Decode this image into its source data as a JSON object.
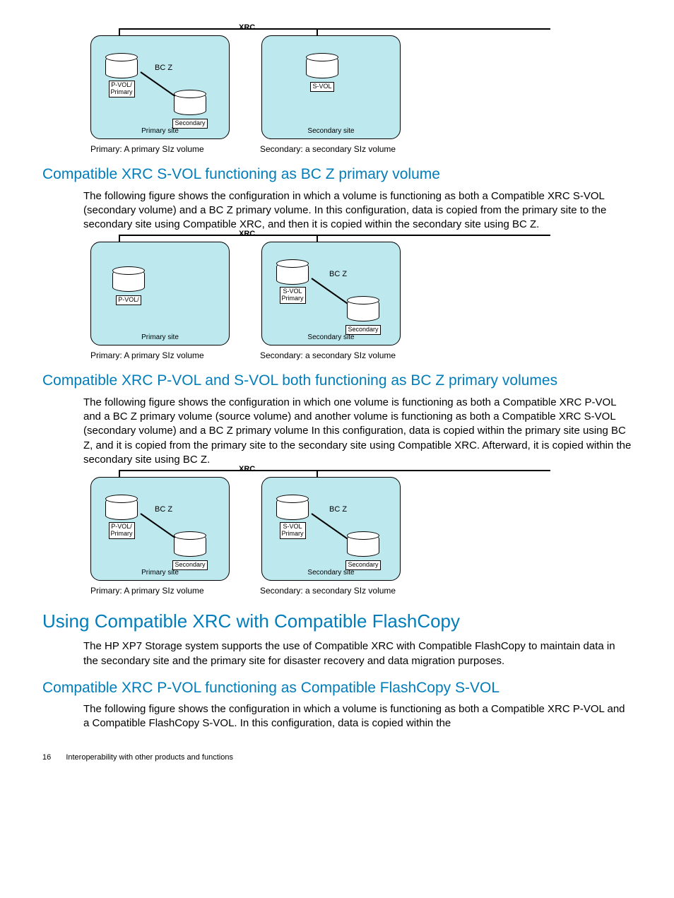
{
  "diagrams": {
    "common": {
      "xrc": "XRC",
      "bcz": "BC Z",
      "primary_site": "Primary site",
      "secondary_site": "Secondary site",
      "caption_left": "Primary: A primary SIz volume",
      "caption_right": "Secondary: a secondary SIz volume",
      "pvol": "P-VOL/",
      "pvol_primary": "Primary",
      "svol": "S-VOL",
      "svol_primary": "Primary",
      "secondary_vol": "Secondary"
    }
  },
  "headings": {
    "h3_a": "Compatible XRC S-VOL functioning as BC Z primary volume",
    "h3_b": "Compatible XRC P-VOL and S-VOL both functioning as BC Z primary volumes",
    "h2_c": "Using Compatible XRC with Compatible FlashCopy",
    "h3_d": "Compatible XRC P-VOL functioning as Compatible FlashCopy S-VOL"
  },
  "paragraphs": {
    "p_a": "The following figure shows the configuration in which a volume is functioning as both a Compatible XRC S-VOL (secondary volume) and a BC Z primary volume. In this configuration, data is copied from the primary site to the secondary site using Compatible XRC, and then it is copied within the secondary site using BC Z.",
    "p_b": "The following figure shows the configuration in which one volume is functioning as both a Compatible XRC P-VOL and a BC Z primary volume (source volume) and another volume is functioning as both a Compatible XRC S-VOL (secondary volume) and a BC Z primary volume In this configuration, data is copied within the primary site using BC Z, and it is copied from the primary site to the secondary site using Compatible XRC. Afterward, it is copied within the secondary site using BC Z.",
    "p_c": "The HP XP7 Storage system supports the use of Compatible XRC with Compatible FlashCopy to maintain data in the secondary site and the primary site for disaster recovery and data migration purposes.",
    "p_d": "The following figure shows the configuration in which a volume is functioning as both a Compatible XRC P-VOL and a Compatible FlashCopy S-VOL. In this configuration, data is copied within the"
  },
  "footer": {
    "page": "16",
    "title": "Interoperability with other products and functions"
  }
}
